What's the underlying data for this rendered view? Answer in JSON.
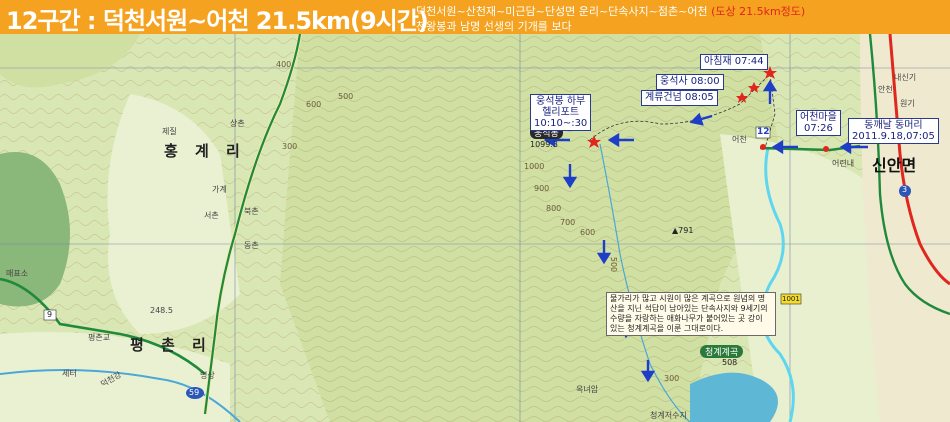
{
  "header": {
    "title": "12구간 : 덕천서원~어천 21.5km(9시간)",
    "route": "덕천서원~산천재~미근담~단성면 운리~단속사지~점촌~어천",
    "distance_note": "(도상 21.5km정도)",
    "theme": "천왕봉과 남명 선생의 기개를 보다"
  },
  "places": {
    "hongye": "홍 계 리",
    "pyeongchon": "평 촌 리",
    "sinanmyeon": "신안면",
    "sangchon": "상촌",
    "jeje": "제질",
    "seochon": "서촌",
    "bukchon": "북촌",
    "gagye": "가계",
    "dongchon": "동촌",
    "pyeongchongyo": "평촌교",
    "myeongsang": "명상",
    "sette": "세터",
    "deokgang": "덕천강",
    "eocheon": "어천",
    "eoryeonae": "어련내",
    "eungseokbong": "웅석봉",
    "eungseokbong_height": "1099.3",
    "cheonggye": "청계계곡",
    "cheonggye_alt": "508",
    "height_791": "▲791",
    "height_2485": "248.5",
    "road_59": "59",
    "road_9": "9",
    "road_1001": "1001",
    "road_3": "3",
    "section_no": "12",
    "okyeo": "옥녀암",
    "cheonggyesu": "청계저수지",
    "maepyo": "매표소",
    "naesin": "내신기",
    "ancheon": "안천",
    "wongi": "원기"
  },
  "callouts": {
    "achimjae": "아침재 07:44",
    "eungseoksa": "웅석사 08:00",
    "gyeryu": "계류건넘 08:05",
    "helipad_line1": "웅석봉 하부",
    "helipad_line2": "헬리포트",
    "helipad_line3": "10:10~:30",
    "eocheon_line1": "어천마을",
    "eocheon_line2": "07:26",
    "start_line1": "동깨날 동머리",
    "start_line2": "2011.9.18,07:05"
  },
  "note_text": "물가리가 많고 시원이 많은 계곡으로 원념의 명산을 지닌 석답이 남아있는 단속사지와 9세기의 수량을 자랑하는 애화나무가 붙어있는 곳 강이 있는 청계계곡을 이룬 그대로이다.",
  "contours": [
    "600",
    "400",
    "500",
    "300",
    "1000",
    "900",
    "800",
    "700",
    "600",
    "500",
    "300"
  ],
  "colors": {
    "header_bg": "#f4a21f",
    "route_blue": "#1e3ec8",
    "road_green": "#1f8a3b",
    "stream_cyan": "#5fd6f0",
    "marker_red": "#e0261d"
  }
}
